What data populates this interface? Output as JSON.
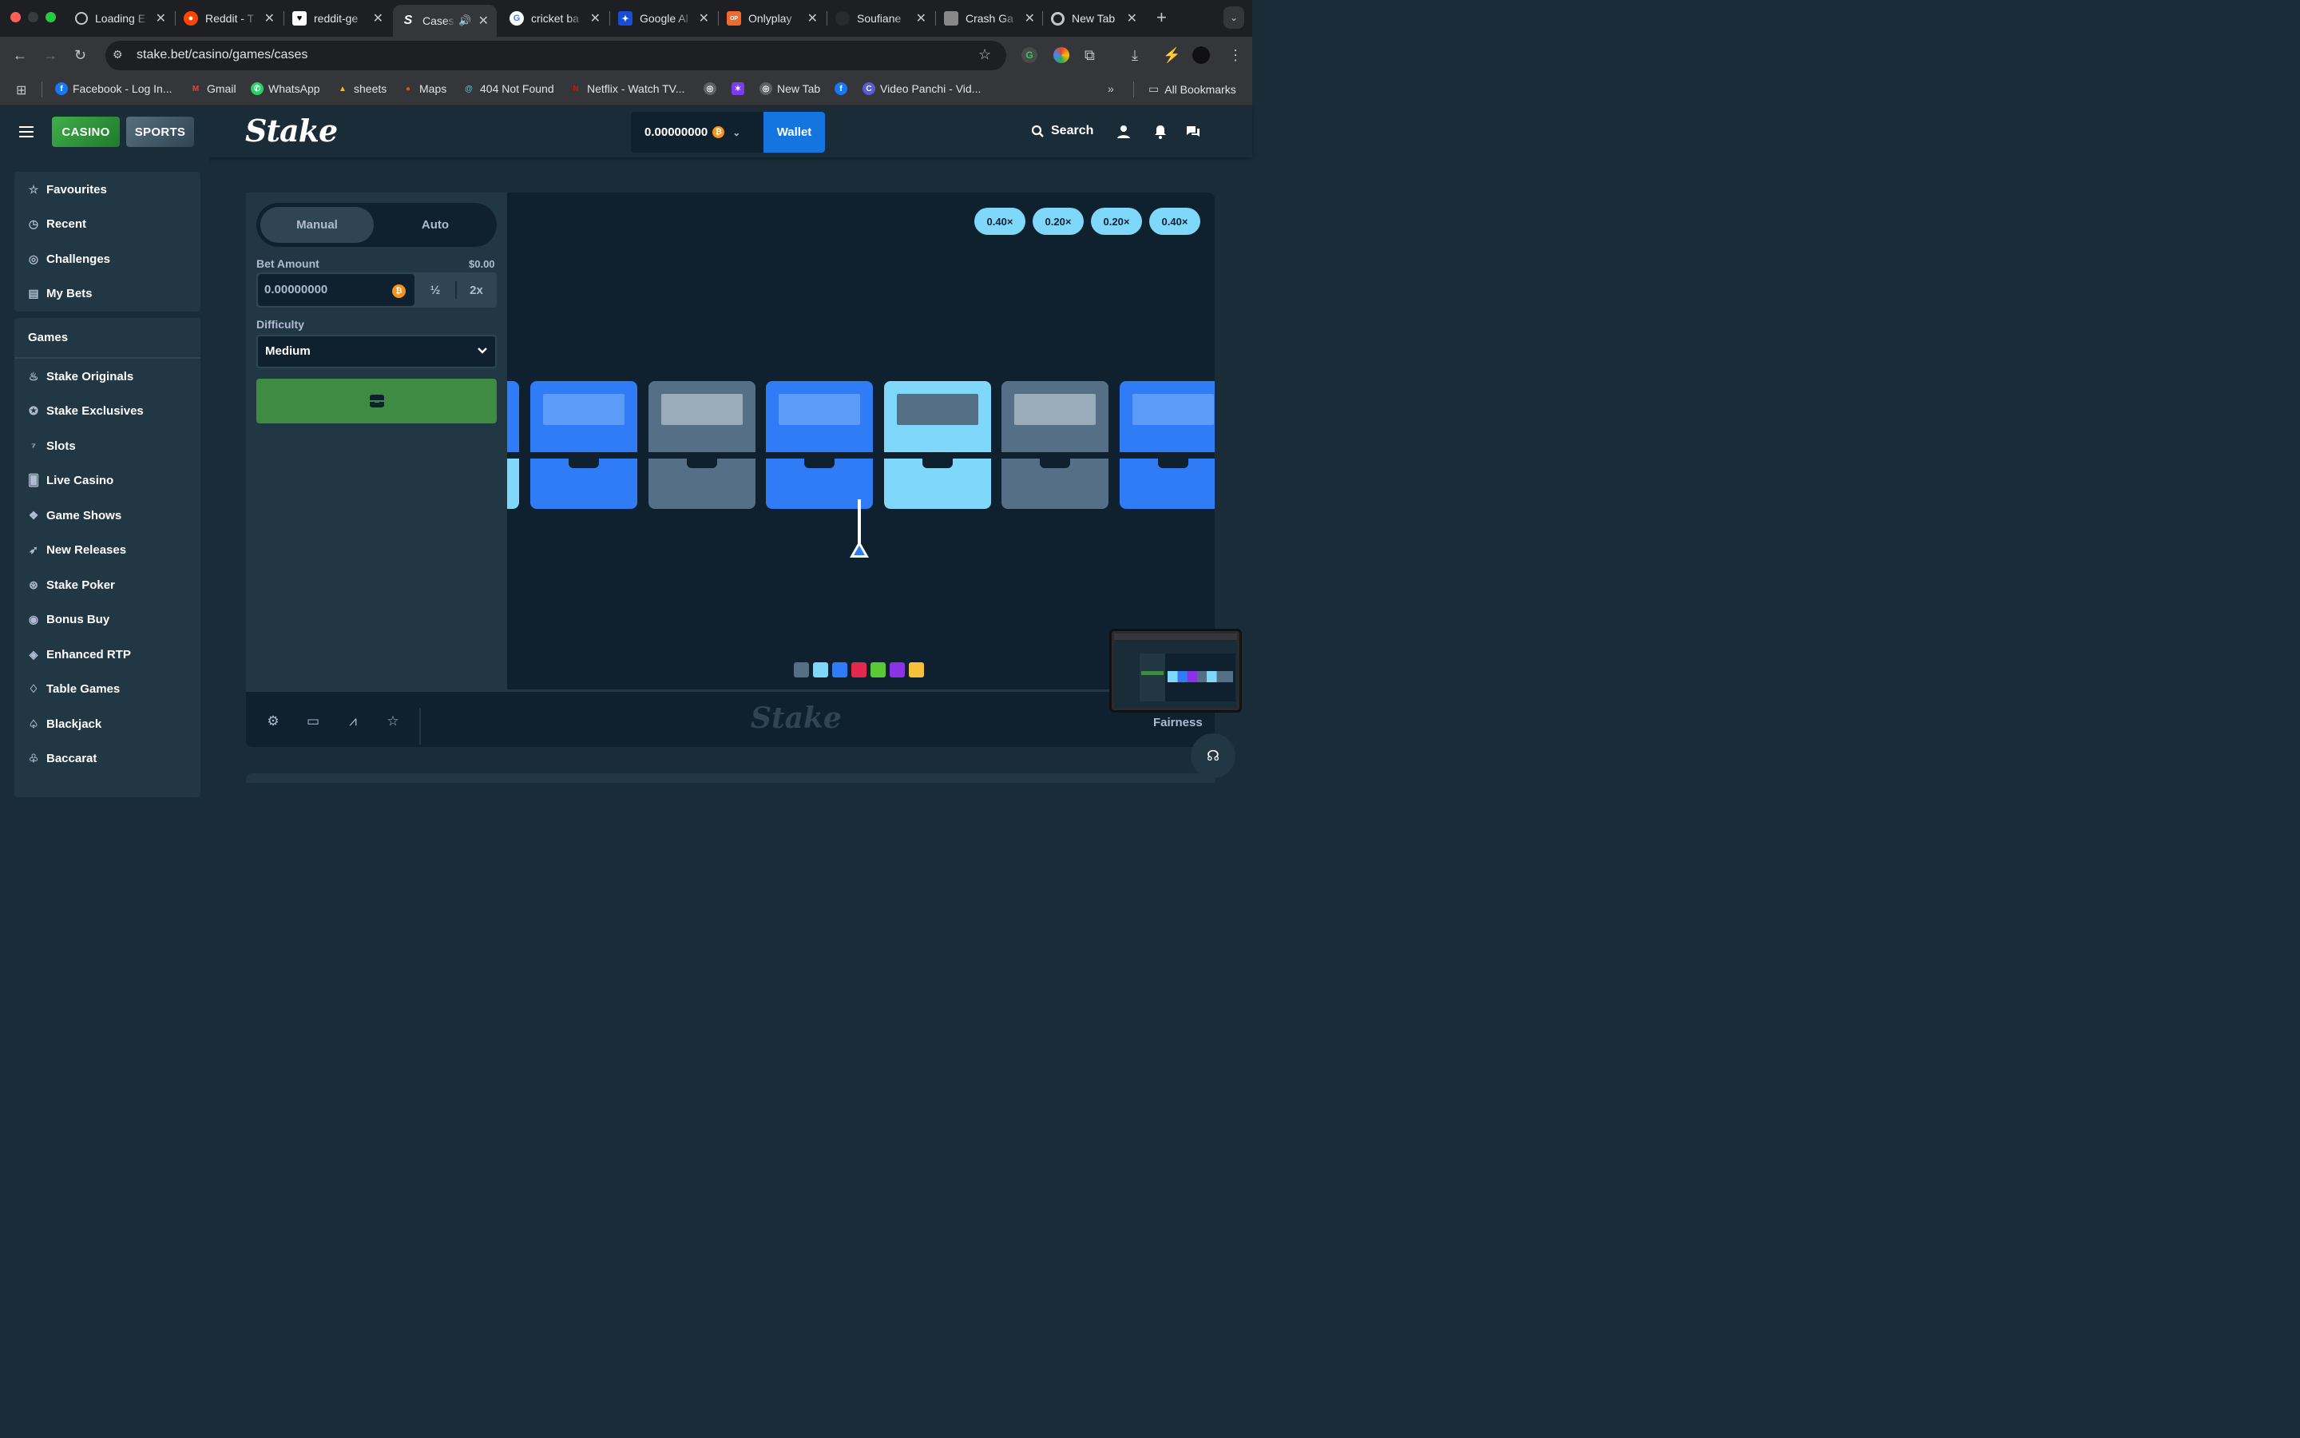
{
  "browser": {
    "tabs": [
      {
        "label": "Loading E",
        "icon": "loading-globe"
      },
      {
        "label": "Reddit - T",
        "icon": "reddit"
      },
      {
        "label": "reddit-ge",
        "icon": "heart"
      },
      {
        "label": "Cases",
        "icon": "stake",
        "active": true,
        "audio": true
      },
      {
        "label": "cricket ba",
        "icon": "google"
      },
      {
        "label": "Google Al",
        "icon": "butterfly"
      },
      {
        "label": "Onlyplay",
        "icon": "onlyplay"
      },
      {
        "label": "Soufiane",
        "icon": "github"
      },
      {
        "label": "Crash Ga",
        "icon": "crash"
      },
      {
        "label": "New Tab",
        "icon": "chrome"
      }
    ],
    "url": "stake.bet/casino/games/cases",
    "bookmarks": [
      {
        "label": "Facebook - Log In...",
        "icon": "facebook"
      },
      {
        "label": "Gmail",
        "icon": "gmail"
      },
      {
        "label": "WhatsApp",
        "icon": "whatsapp"
      },
      {
        "label": "sheets",
        "icon": "drive"
      },
      {
        "label": "Maps",
        "icon": "maps"
      },
      {
        "label": "404 Not Found",
        "icon": "spiral"
      },
      {
        "label": "Netflix - Watch TV...",
        "icon": "netflix"
      },
      {
        "label": "",
        "icon": "globe"
      },
      {
        "label": "",
        "icon": "star-app"
      },
      {
        "label": "New Tab",
        "icon": "globe"
      },
      {
        "label": "",
        "icon": "facebook"
      },
      {
        "label": "Video Panchi - Vid...",
        "icon": "c-logo"
      }
    ],
    "all_bookmarks": "All Bookmarks"
  },
  "header": {
    "casino": "CASINO",
    "sports": "SPORTS",
    "logo": "Stake",
    "balance": "0.00000000",
    "wallet": "Wallet",
    "search": "Search"
  },
  "sidebar": {
    "top": [
      "Favourites",
      "Recent",
      "Challenges",
      "My Bets"
    ],
    "games_heading": "Games",
    "games": [
      "Stake Originals",
      "Stake Exclusives",
      "Slots",
      "Live Casino",
      "Game Shows",
      "New Releases",
      "Stake Poker",
      "Bonus Buy",
      "Enhanced RTP",
      "Table Games",
      "Blackjack",
      "Baccarat"
    ]
  },
  "controls": {
    "manual": "Manual",
    "auto": "Auto",
    "bet_amount_label": "Bet Amount",
    "bet_amount_usd": "$0.00",
    "bet_value": "0.00000000",
    "half": "½",
    "double": "2x",
    "difficulty_label": "Difficulty",
    "difficulty_value": "Medium"
  },
  "board": {
    "multipliers": [
      "0.40×",
      "0.20×",
      "0.20×",
      "0.40×"
    ],
    "cases": [
      "blue",
      "gray",
      "blue",
      "lightblue",
      "gray",
      "blue"
    ],
    "legend_colors": [
      "#557086",
      "#7fd8f9",
      "#2f7cf6",
      "#e4284d",
      "#5ac832",
      "#8b32e6",
      "#f8c13a"
    ]
  },
  "footer": {
    "watermark": "Stake",
    "fairness": "Fairness"
  },
  "colors": {
    "blue_case": "#2f7cf6",
    "blue_window": "#5c9cf8",
    "gray_case": "#557086",
    "gray_window": "#9aabb9",
    "light_case": "#7fd8f9",
    "light_window": "#557086",
    "bet_button": "#3e8c44",
    "wallet": "#1475e1"
  }
}
